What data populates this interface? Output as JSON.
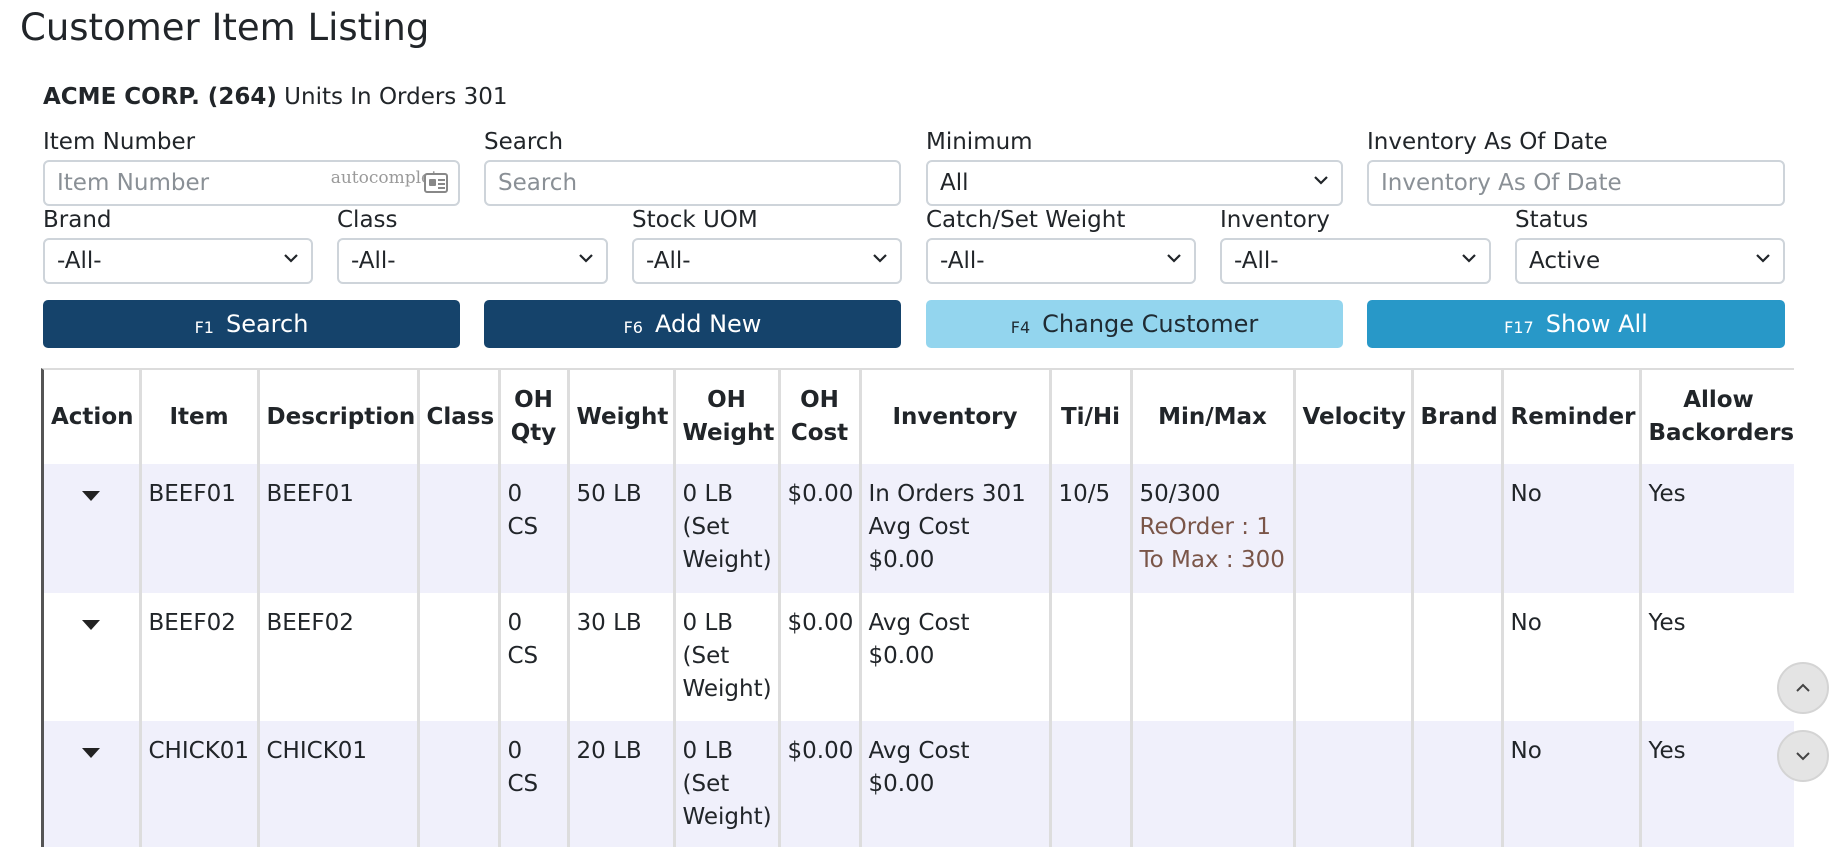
{
  "page": {
    "title": "Customer Item Listing"
  },
  "customer": {
    "name": "ACME CORP. (264)",
    "units_text": "Units In Orders 301"
  },
  "filters": {
    "item_number": {
      "label": "Item Number",
      "placeholder": "Item Number",
      "tag": "autocomplete"
    },
    "search": {
      "label": "Search",
      "placeholder": "Search"
    },
    "minimum": {
      "label": "Minimum",
      "value": "All"
    },
    "inventory_date": {
      "label": "Inventory As Of Date",
      "placeholder": "Inventory As Of Date"
    },
    "brand": {
      "label": "Brand",
      "value": "-All-"
    },
    "class": {
      "label": "Class",
      "value": "-All-"
    },
    "stock_uom": {
      "label": "Stock UOM",
      "value": "-All-"
    },
    "catch_weight": {
      "label": "Catch/Set Weight",
      "value": "-All-"
    },
    "inventory": {
      "label": "Inventory",
      "value": "-All-"
    },
    "status": {
      "label": "Status",
      "value": "Active"
    }
  },
  "buttons": {
    "search": {
      "key": "F1",
      "label": "Search"
    },
    "add_new": {
      "key": "F6",
      "label": "Add New"
    },
    "change_customer": {
      "key": "F4",
      "label": "Change Customer"
    },
    "show_all": {
      "key": "F17",
      "label": "Show All"
    }
  },
  "colors": {
    "dark_button": "#15436b",
    "light_button": "#93d5ee",
    "mid_button": "#2898c8",
    "row_tint": "#f0f0fb",
    "reorder_text": "#7a5548"
  },
  "table": {
    "headers": {
      "action": "Action",
      "item": "Item",
      "description": "Description",
      "class": "Class",
      "oh_qty_1": "OH",
      "oh_qty_2": "Qty",
      "weight": "Weight",
      "oh_weight_1": "OH",
      "oh_weight_2": "Weight",
      "oh_cost_1": "OH",
      "oh_cost_2": "Cost",
      "inventory": "Inventory",
      "ti_hi": "Ti/Hi",
      "min_max": "Min/Max",
      "velocity": "Velocity",
      "brand": "Brand",
      "reminder": "Reminder",
      "allow_1": "Allow",
      "allow_2": "Backorders"
    },
    "rows": [
      {
        "item": "BEEF01",
        "description": "BEEF01",
        "class": "",
        "oh_qty": "0 CS",
        "weight": "50 LB",
        "oh_weight_1": "0 LB",
        "oh_weight_2": "(Set",
        "oh_weight_3": "Weight)",
        "oh_cost": "$0.00",
        "inventory_1": "In Orders 301",
        "inventory_2": "Avg Cost $0.00",
        "ti_hi": "10/5",
        "min_max": "50/300",
        "reorder": "ReOrder : 1",
        "to_max": "To Max : 300",
        "velocity": "",
        "brand": "",
        "reminder": "No",
        "allow_backorders": "Yes"
      },
      {
        "item": "BEEF02",
        "description": "BEEF02",
        "class": "",
        "oh_qty": "0 CS",
        "weight": "30 LB",
        "oh_weight_1": "0 LB",
        "oh_weight_2": "(Set",
        "oh_weight_3": "Weight)",
        "oh_cost": "$0.00",
        "inventory_1": "Avg Cost $0.00",
        "inventory_2": "",
        "ti_hi": "",
        "min_max": "",
        "reorder": "",
        "to_max": "",
        "velocity": "",
        "brand": "",
        "reminder": "No",
        "allow_backorders": "Yes"
      },
      {
        "item": "CHICK01",
        "description": "CHICK01",
        "class": "",
        "oh_qty": "0 CS",
        "weight": "20 LB",
        "oh_weight_1": "0 LB",
        "oh_weight_2": "(Set",
        "oh_weight_3": "Weight)",
        "oh_cost": "$0.00",
        "inventory_1": "Avg Cost $0.00",
        "inventory_2": "",
        "ti_hi": "",
        "min_max": "",
        "reorder": "",
        "to_max": "",
        "velocity": "",
        "brand": "",
        "reminder": "No",
        "allow_backorders": "Yes"
      }
    ]
  }
}
